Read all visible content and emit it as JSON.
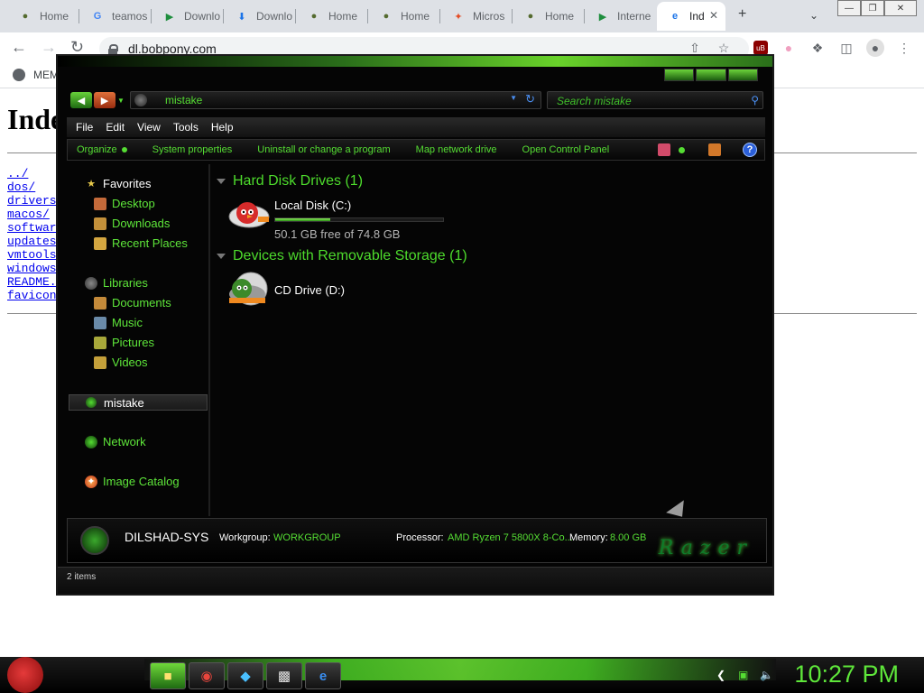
{
  "browser": {
    "tabs": [
      {
        "title": "Home",
        "icon": "site-icon"
      },
      {
        "title": "teamos",
        "icon": "google-icon"
      },
      {
        "title": "Downlo",
        "icon": "play-icon"
      },
      {
        "title": "Downlo",
        "icon": "download-icon"
      },
      {
        "title": "Home",
        "icon": "site-icon"
      },
      {
        "title": "Home",
        "icon": "site-icon"
      },
      {
        "title": "Micros",
        "icon": "joomla-icon"
      },
      {
        "title": "Home",
        "icon": "site-icon"
      },
      {
        "title": "Interne",
        "icon": "play-icon"
      },
      {
        "title": "Ind",
        "icon": "ie-icon",
        "active": true
      }
    ],
    "url": "dl.bobpony.com",
    "bookmark": "MEM"
  },
  "page": {
    "heading": "Inde",
    "links": [
      "../",
      "dos/",
      "drivers/",
      "macos/",
      "software",
      "updates/",
      "vmtools/",
      "windows/",
      "README.t",
      "favicon."
    ]
  },
  "explorer": {
    "address": "mistake",
    "search_placeholder": "Search mistake",
    "menu": [
      "File",
      "Edit",
      "View",
      "Tools",
      "Help"
    ],
    "commands": [
      "Organize",
      "System properties",
      "Uninstall or change a program",
      "Map network drive",
      "Open Control Panel"
    ],
    "nav": {
      "favorites": "Favorites",
      "favorite_items": [
        "Desktop",
        "Downloads",
        "Recent Places"
      ],
      "libraries": "Libraries",
      "library_items": [
        "Documents",
        "Music",
        "Pictures",
        "Videos"
      ],
      "computer": "mistake",
      "network": "Network",
      "image_catalog": "Image Catalog"
    },
    "groups": {
      "hdd_header": "Hard Disk Drives (1)",
      "removable_header": "Devices with Removable Storage (1)"
    },
    "drives": {
      "local": {
        "name": "Local Disk (C:)",
        "free_text": "50.1 GB free of 74.8 GB",
        "used_fraction": 0.33
      },
      "cd": {
        "name": "CD Drive (D:)"
      }
    },
    "details": {
      "pc_name": "DILSHAD-SYS",
      "workgroup_label": "Workgroup:",
      "workgroup": "WORKGROUP",
      "processor_label": "Processor:",
      "processor": "AMD Ryzen 7 5800X 8-Co...",
      "memory_label": "Memory:",
      "memory": "8.00 GB",
      "brand": "Razer"
    },
    "status": "2 items"
  },
  "taskbar": {
    "clock": "10:27 PM",
    "apps": [
      "explorer-icon",
      "chrome-icon",
      "network-icon",
      "media-icon",
      "ie-icon"
    ]
  },
  "colors": {
    "accent": "#55dd33",
    "explorer_bg": "#050505",
    "link": "#0000ee"
  }
}
